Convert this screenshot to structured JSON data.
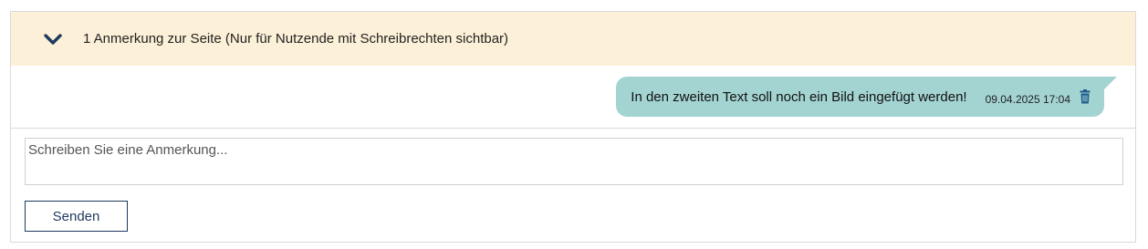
{
  "header": {
    "title": "1 Anmerkung zur Seite (Nur für Nutzende mit Schreibrechten sichtbar)",
    "toggle_icon": "chevron-down-icon",
    "background_color": "#fdf0d8"
  },
  "messages": [
    {
      "text": "In den zweiten Text soll noch ein Bild eingefügt werden!",
      "timestamp": "09.04.2025 17:04",
      "delete_icon": "trash-icon",
      "bubble_color": "#a3d4d2"
    }
  ],
  "compose": {
    "placeholder": "Schreiben Sie eine Anmerkung...",
    "value": "",
    "send_label": "Senden"
  },
  "colors": {
    "accent": "#1e3a5f",
    "border": "#d9d9d9"
  }
}
